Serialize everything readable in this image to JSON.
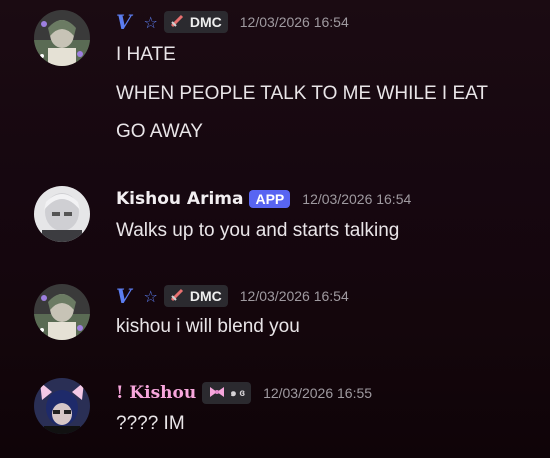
{
  "messages": [
    {
      "username": "V",
      "server_tag": "DMC",
      "timestamp": "12/03/2026 16:54",
      "lines": [
        "I HATE",
        "WHEN PEOPLE TALK TO ME WHILE I EAT",
        "GO AWAY"
      ]
    },
    {
      "username": "Kishou Arima",
      "badge": "APP",
      "timestamp": "12/03/2026 16:54",
      "lines": [
        "Walks up to you and starts talking"
      ]
    },
    {
      "username": "V",
      "server_tag": "DMC",
      "timestamp": "12/03/2026 16:54",
      "lines": [
        "kishou i will blend you"
      ]
    },
    {
      "username": "! Kishou",
      "server_tag": "๑ ɞ",
      "timestamp": "12/03/2026 16:55",
      "lines": [
        "???? IM"
      ]
    }
  ],
  "colors": {
    "background": "#1b0b12",
    "v_name": "#5b7df0",
    "kishou_name": "#f7a6dc",
    "app_badge": "#5865f2",
    "timestamp": "#9f9aa0"
  },
  "icons": {
    "dmc_tag": "sword-icon",
    "kishou_tag": "pink-bow-icon",
    "v_star": "star-outline-icon"
  }
}
